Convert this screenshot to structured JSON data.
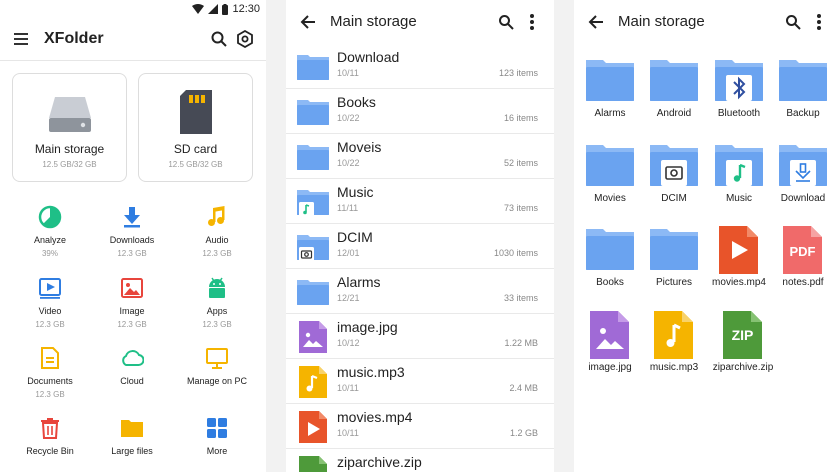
{
  "status": {
    "time": "12:30"
  },
  "home": {
    "title": "XFolder",
    "storage": [
      {
        "label": "Main storage",
        "sub": "12.5 GB/32 GB"
      },
      {
        "label": "SD card",
        "sub": "12.5 GB/32 GB"
      }
    ],
    "grid": [
      {
        "label": "Analyze",
        "sub": "39%",
        "icon": "analyze-icon"
      },
      {
        "label": "Downloads",
        "sub": "12.3 GB",
        "icon": "download-icon"
      },
      {
        "label": "Audio",
        "sub": "12.3 GB",
        "icon": "music-note-icon"
      },
      {
        "label": "Video",
        "sub": "12.3 GB",
        "icon": "video-icon"
      },
      {
        "label": "Image",
        "sub": "12.3 GB",
        "icon": "image-icon"
      },
      {
        "label": "Apps",
        "sub": "12.3 GB",
        "icon": "android-icon"
      },
      {
        "label": "Documents",
        "sub": "12.3 GB",
        "icon": "document-icon"
      },
      {
        "label": "Cloud",
        "sub": "",
        "icon": "cloud-icon"
      },
      {
        "label": "Manage on PC",
        "sub": "",
        "icon": "monitor-icon"
      },
      {
        "label": "Recycle Bin",
        "sub": "",
        "icon": "trash-icon"
      },
      {
        "label": "Large files",
        "sub": "",
        "icon": "folder-icon"
      },
      {
        "label": "More",
        "sub": "",
        "icon": "grid-icon"
      }
    ]
  },
  "list_view": {
    "title": "Main storage",
    "rows": [
      {
        "name": "Download",
        "date": "10/11",
        "meta": "123 items",
        "icon": "folder-icon"
      },
      {
        "name": "Books",
        "date": "10/22",
        "meta": "16 items",
        "icon": "folder-icon"
      },
      {
        "name": "Moveis",
        "date": "10/22",
        "meta": "52 items",
        "icon": "folder-icon"
      },
      {
        "name": "Music",
        "date": "11/11",
        "meta": "73 items",
        "icon": "music-folder-icon"
      },
      {
        "name": "DCIM",
        "date": "12/01",
        "meta": "1030 items",
        "icon": "camera-folder-icon"
      },
      {
        "name": "Alarms",
        "date": "12/21",
        "meta": "33 items",
        "icon": "folder-icon"
      },
      {
        "name": "image.jpg",
        "date": "10/12",
        "meta": "1.22 MB",
        "icon": "image-file-icon"
      },
      {
        "name": "music.mp3",
        "date": "10/11",
        "meta": "2.4 MB",
        "icon": "audio-file-icon"
      },
      {
        "name": "movies.mp4",
        "date": "10/11",
        "meta": "1.2 GB",
        "icon": "video-file-icon"
      },
      {
        "name": "ziparchive.zip",
        "date": "",
        "meta": "",
        "icon": "zip-file-icon"
      }
    ]
  },
  "grid_view": {
    "title": "Main storage",
    "tiles": [
      {
        "name": "Alarms",
        "icon": "folder-icon"
      },
      {
        "name": "Android",
        "icon": "folder-icon"
      },
      {
        "name": "Bluetooth",
        "icon": "bluetooth-folder-icon"
      },
      {
        "name": "Backup",
        "icon": "folder-icon"
      },
      {
        "name": "Movies",
        "icon": "folder-icon"
      },
      {
        "name": "DCIM",
        "icon": "camera-folder-icon"
      },
      {
        "name": "Music",
        "icon": "music-folder-icon"
      },
      {
        "name": "Download",
        "icon": "download-folder-icon"
      },
      {
        "name": "Books",
        "icon": "folder-icon"
      },
      {
        "name": "Pictures",
        "icon": "folder-icon"
      },
      {
        "name": "movies.mp4",
        "icon": "video-file-icon"
      },
      {
        "name": "notes.pdf",
        "icon": "pdf-file-icon"
      },
      {
        "name": "image.jpg",
        "icon": "image-file-icon"
      },
      {
        "name": "music.mp3",
        "icon": "audio-file-icon"
      },
      {
        "name": "ziparchive.zip",
        "icon": "zip-file-icon"
      }
    ]
  },
  "colors": {
    "folder": "#6aa3f0",
    "folder_tab": "#8cb9f5",
    "accent_blue": "#2f7de1",
    "green": "#1fbf87",
    "yellow": "#f5b400",
    "red": "#e8453c",
    "purple": "#a06ad6",
    "orange": "#f07a1c",
    "pdf_red": "#f06a6a",
    "zip_green": "#4e9a3a"
  }
}
